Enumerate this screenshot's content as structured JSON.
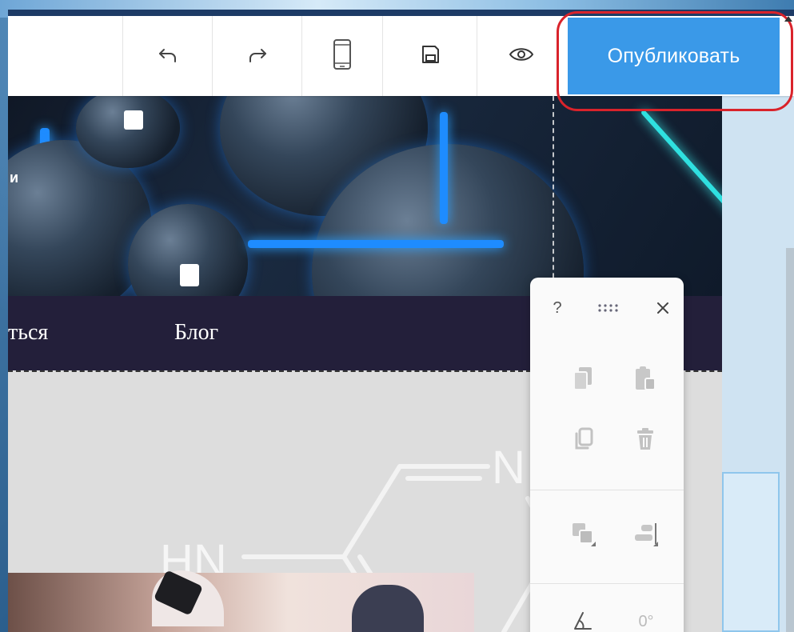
{
  "toolbar": {
    "undo_icon": "undo-icon",
    "redo_icon": "redo-icon",
    "mobile_icon": "mobile-phone-icon",
    "save_icon": "save-icon",
    "preview_icon": "eye-icon",
    "publish_label": "Опубликовать",
    "publish_color": "#3a99e8",
    "highlight_color": "#d9232b"
  },
  "hero": {
    "partial_text": "и"
  },
  "navbar": {
    "links": [
      {
        "label": "ться"
      },
      {
        "label": "Блог"
      }
    ]
  },
  "content": {
    "molecule_labels": [
      "N",
      "HN"
    ]
  },
  "element_panel": {
    "help_label": "?",
    "drag_icon": "drag-handle-icon",
    "close_icon": "close-icon",
    "copy_icon": "copy-icon",
    "paste_icon": "paste-icon",
    "duplicate_icon": "duplicate-icon",
    "delete_icon": "trash-icon",
    "layer_icon": "layer-order-icon",
    "align_icon": "align-right-icon",
    "rotate_icon": "angle-icon",
    "rotate_value": "0°"
  }
}
